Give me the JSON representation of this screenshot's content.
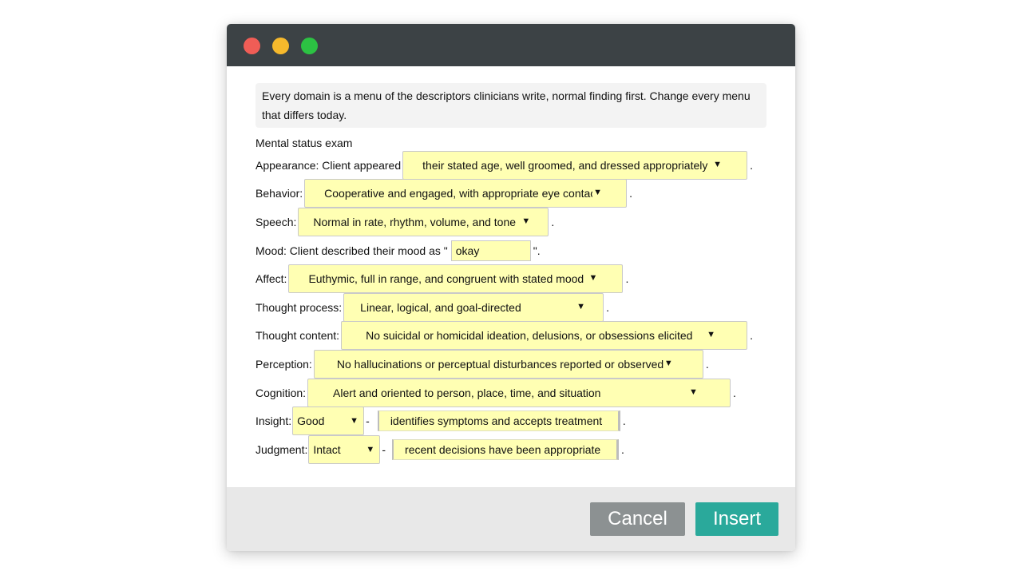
{
  "notice": "Every domain is a menu of the descriptors clinicians write, normal finding first. Change every menu that differs today.",
  "section_title": "Mental status exam",
  "appearance": {
    "label": "Appearance: Client appeared",
    "value": "their stated age, well groomed, and dressed appropriately"
  },
  "behavior": {
    "label": "Behavior:",
    "value": "Cooperative and engaged, with appropriate eye contact"
  },
  "speech": {
    "label": "Speech:",
    "value": "Normal in rate, rhythm, volume, and tone"
  },
  "mood": {
    "label": "Mood: Client described their mood as \"",
    "value": "okay",
    "suffix": "\"."
  },
  "affect": {
    "label": "Affect:",
    "value": "Euthymic, full in range, and congruent with stated mood"
  },
  "thought_process": {
    "label": "Thought process:",
    "value": "Linear, logical, and goal-directed"
  },
  "thought_content": {
    "label": "Thought content:",
    "value": "No suicidal or homicidal ideation, delusions, or obsessions elicited"
  },
  "perception": {
    "label": "Perception:",
    "value": "No hallucinations or perceptual disturbances reported or observed"
  },
  "cognition": {
    "label": "Cognition:",
    "value": "Alert and oriented to person, place, time, and situation"
  },
  "insight": {
    "label": "Insight:",
    "value": "Good",
    "detail": "identifies symptoms and accepts treatment"
  },
  "judgment": {
    "label": "Judgment:",
    "value": "Intact",
    "detail": "recent decisions have been appropriate"
  },
  "period": ".",
  "dash": "-",
  "arrow_glyph": "▼",
  "buttons": {
    "cancel": "Cancel",
    "insert": "Insert"
  },
  "colors": {
    "titlebar": "#3c4245",
    "field": "#ffffb3",
    "cancel": "#8c9192",
    "insert": "#2aa99b"
  }
}
